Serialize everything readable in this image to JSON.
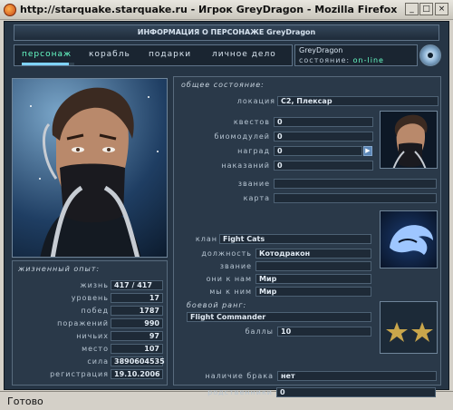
{
  "window": {
    "title": "http://starquake.starquake.ru - Игрок GreyDragon - Mozilla Firefox",
    "status": "Готово"
  },
  "header": {
    "title": "ИНФОРМАЦИЯ О ПЕРСОНАЖЕ GreyDragon"
  },
  "nav": {
    "items": [
      "персонаж",
      "корабль",
      "подарки",
      "личное дело"
    ],
    "active": "персонаж",
    "progress": 0.9
  },
  "player": {
    "name": "GreyDragon",
    "status_label": "состояние:",
    "status_value": "on-line"
  },
  "experience": {
    "title": "жизненный опыт:",
    "rows": [
      {
        "label": "жизнь",
        "value": "417 / 417"
      },
      {
        "label": "уровень",
        "value": "17"
      },
      {
        "label": "побед",
        "value": "1787"
      },
      {
        "label": "поражений",
        "value": "990"
      },
      {
        "label": "ничьих",
        "value": "97"
      },
      {
        "label": "место",
        "value": "107"
      },
      {
        "label": "сила",
        "value": "3890604535"
      },
      {
        "label": "регистрация",
        "value": "19.10.2006"
      }
    ]
  },
  "general": {
    "title": "общее состояние:",
    "location_label": "локация",
    "location_value": "C2, Плексар",
    "quests_label": "квестов",
    "quests_value": "0",
    "biomodules_label": "биомодулей",
    "biomodules_value": "0",
    "awards_label": "наград",
    "awards_value": "0",
    "punishments_label": "наказаний",
    "punishments_value": "0",
    "title_label": "звание",
    "title_value": "",
    "card_label": "карта",
    "card_value": ""
  },
  "clan": {
    "label": "клан",
    "value": "Fight Cats",
    "position_label": "должность",
    "position_value": "Котодракон",
    "rank_label": "звание",
    "rank_value": "",
    "they_to_us_label": "они к нам",
    "they_to_us_value": "Мир",
    "we_to_them_label": "мы к ним",
    "we_to_them_value": "Мир"
  },
  "combat": {
    "title": "боевой ранг:",
    "rank_value": "Flight Commander",
    "points_label": "баллы",
    "points_value": "10"
  },
  "social": {
    "marriage_label": "наличие брака",
    "marriage_value": "нет",
    "relatives_label": "родственники",
    "relatives_value": "0"
  },
  "colors": {
    "accent": "#67ffc8",
    "panel": "#2a3949",
    "frame": "#263545"
  }
}
